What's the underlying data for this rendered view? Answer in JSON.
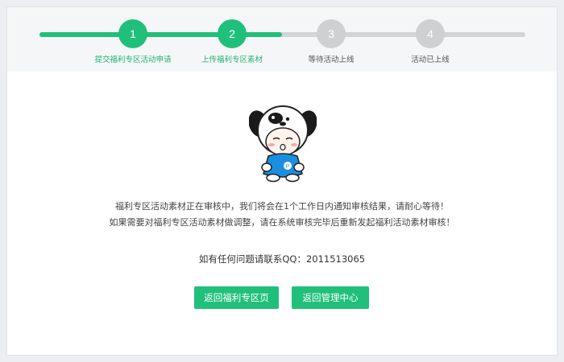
{
  "colors": {
    "accent": "#21c07a",
    "pending": "#cfd0d2"
  },
  "progress": {
    "completed_steps": 2,
    "total_steps": 4
  },
  "steps": [
    {
      "number": "1",
      "label": "提交福利专区活动申请",
      "state": "done"
    },
    {
      "number": "2",
      "label": "上传福利专区素材",
      "state": "done"
    },
    {
      "number": "3",
      "label": "等待活动上线",
      "state": "todo"
    },
    {
      "number": "4",
      "label": "活动已上线",
      "state": "todo"
    }
  ],
  "mascot": {
    "icon": "cartoon-dog-hat-mascot"
  },
  "message": {
    "line1": "福利专区活动素材正在审核中，我们将会在1个工作日内通知审核结果，请耐心等待！",
    "line2": "如果需要对福利专区活动素材做调整，请在系统审核完毕后重新发起福利活动素材审核！"
  },
  "contact": {
    "text": "如有任何问题请联系QQ：2011513065"
  },
  "buttons": {
    "welfare": "返回福利专区页",
    "manage": "返回管理中心"
  }
}
